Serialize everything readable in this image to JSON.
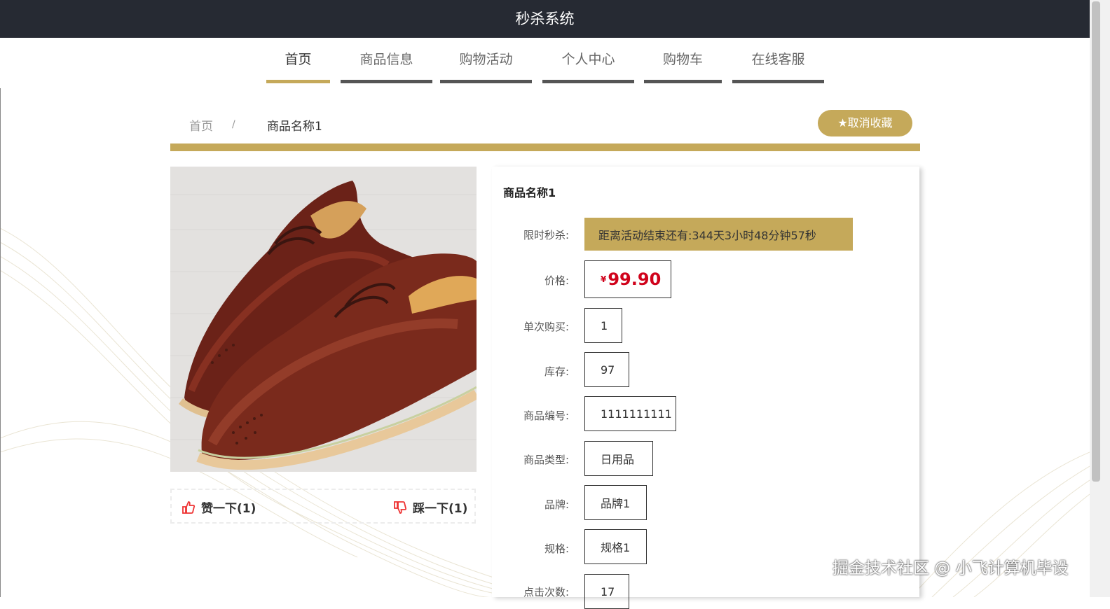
{
  "app_title": "秒杀系统",
  "nav": [
    "首页",
    "商品信息",
    "购物活动",
    "个人中心",
    "购物车",
    "在线客服"
  ],
  "breadcrumb": {
    "home": "首页",
    "sep": "/",
    "current": "商品名称1"
  },
  "favorite_button": "取消收藏",
  "product": {
    "name": "商品名称1",
    "countdown_label": "限时秒杀:",
    "countdown_text": "距离活动结束还有:344天3小时48分钟57秒",
    "price_label": "价格:",
    "price_currency": "¥",
    "price": "99.90",
    "per_purchase_label": "单次购买:",
    "per_purchase": "1",
    "stock_label": "库存:",
    "stock": "97",
    "code_label": "商品编号:",
    "code": "1111111111",
    "type_label": "商品类型:",
    "type": "日用品",
    "brand_label": "品牌:",
    "brand": "品牌1",
    "spec_label": "规格:",
    "spec": "规格1",
    "clicks_label": "点击次数:",
    "clicks": "17"
  },
  "votes": {
    "like": "赞一下(1)",
    "dislike": "踩一下(1)"
  },
  "watermark": "掘金技术社区 @ 小飞计算机毕设",
  "colors": {
    "header": "#262a33",
    "accent": "#c5a95a",
    "price": "#d0021b"
  },
  "icons": [
    "thumbs-up-icon",
    "thumbs-down-icon",
    "star-icon"
  ]
}
